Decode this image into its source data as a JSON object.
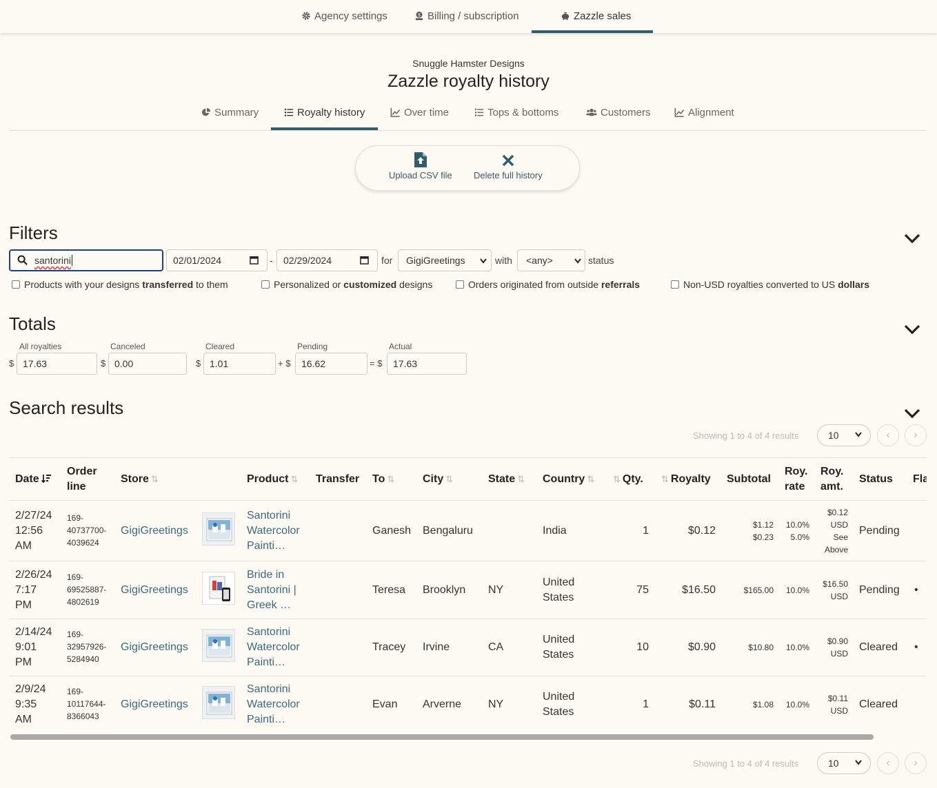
{
  "topnav": {
    "items": [
      {
        "label": "Agency settings",
        "icon": "gear-icon"
      },
      {
        "label": "Billing / subscription",
        "icon": "user-dollar-icon"
      },
      {
        "label": "Zazzle sales",
        "icon": "piggy-bank-icon"
      }
    ],
    "active_index": 2
  },
  "header": {
    "subtitle": "Snuggle Hamster Designs",
    "title": "Zazzle royalty history"
  },
  "tabs": [
    {
      "label": "Summary",
      "icon": "pie-chart-icon"
    },
    {
      "label": "Royalty history",
      "icon": "list-icon"
    },
    {
      "label": "Over time",
      "icon": "line-chart-icon"
    },
    {
      "label": "Tops & bottoms",
      "icon": "list-icon"
    },
    {
      "label": "Customers",
      "icon": "users-icon"
    },
    {
      "label": "Alignment",
      "icon": "line-chart-icon"
    }
  ],
  "actions": {
    "upload": "Upload CSV file",
    "delete": "Delete full history"
  },
  "filters": {
    "heading": "Filters",
    "search_value": "santorini",
    "date_from": "02/01/2024",
    "date_sep": "-",
    "date_to": "02/29/2024",
    "for_label": "for",
    "store_value": "GigiGreetings",
    "with_label": "with",
    "status_value": "<any>",
    "status_label": "status",
    "checkboxes": [
      {
        "pre": "Products with your designs ",
        "bold": "transferred",
        "post": " to them",
        "checked": false
      },
      {
        "pre": "Personalized or ",
        "bold": "customized",
        "post": " designs",
        "checked": false
      },
      {
        "pre": "Orders originated from outside ",
        "bold": "referrals",
        "post": "",
        "checked": false
      },
      {
        "pre": "Non-USD royalties converted to US ",
        "bold": "dollars",
        "post": "",
        "checked": false
      }
    ]
  },
  "totals": {
    "heading": "Totals",
    "currency": "$",
    "all_label": "All royalties",
    "all_value": "17.63",
    "canceled_label": "Canceled",
    "canceled_value": "0.00",
    "cleared_label": "Cleared",
    "cleared_value": "1.01",
    "plus": "+ $",
    "pending_label": "Pending",
    "pending_value": "16.62",
    "equals": "= $",
    "actual_label": "Actual",
    "actual_value": "17.63"
  },
  "results": {
    "heading": "Search results",
    "showing": "Showing 1 to 4 of 4 results",
    "page_size": "10",
    "prev": "‹",
    "next": "›",
    "columns": {
      "date": "Date",
      "order1": "Order",
      "order2": "line",
      "store": "Store",
      "product": "Product",
      "transfer": "Transfer",
      "to": "To",
      "city": "City",
      "state": "State",
      "country": "Country",
      "qty": "Qty.",
      "royalty": "Royalty",
      "subtotal": "Subtotal",
      "royrate1": "Roy.",
      "royrate2": "rate",
      "royamt1": "Roy.",
      "royamt2": "amt.",
      "status": "Status",
      "flag": "Fla"
    },
    "rows": [
      {
        "d1": "2/27/24",
        "d2": "12:56",
        "d3": "AM",
        "o1": "169-",
        "o2": "40737700-",
        "o3": "4039624",
        "store": "GigiGreetings",
        "p1": "Santorini",
        "p2": "Watercolor",
        "p3": "Painti…",
        "to": "Ganesh",
        "city": "Bengaluru",
        "state": "",
        "c1": "India",
        "c2": "",
        "qty": "1",
        "royalty": "$0.12",
        "s1": "$1.12",
        "s2": "$0.23",
        "r1": "10.0%",
        "r2": "5.0%",
        "a1": "$0.12",
        "a2": "USD",
        "a3": "See",
        "a4": "Above",
        "status": "Pending",
        "flag": ""
      },
      {
        "d1": "2/26/24",
        "d2": "7:17",
        "d3": "PM",
        "o1": "169-",
        "o2": "69525887-",
        "o3": "4802619",
        "store": "GigiGreetings",
        "p1": "Bride in",
        "p2": "Santorini |",
        "p3": "Greek …",
        "to": "Teresa",
        "city": "Brooklyn",
        "state": "NY",
        "c1": "United",
        "c2": "States",
        "qty": "75",
        "royalty": "$16.50",
        "s1": "$165.00",
        "s2": "",
        "r1": "10.0%",
        "r2": "",
        "a1": "$16.50",
        "a2": "USD",
        "a3": "",
        "a4": "",
        "status": "Pending",
        "flag": "•"
      },
      {
        "d1": "2/14/24",
        "d2": "9:01",
        "d3": "PM",
        "o1": "169-",
        "o2": "32957926-",
        "o3": "5284940",
        "store": "GigiGreetings",
        "p1": "Santorini",
        "p2": "Watercolor",
        "p3": "Painti…",
        "to": "Tracey",
        "city": "Irvine",
        "state": "CA",
        "c1": "United",
        "c2": "States",
        "qty": "10",
        "royalty": "$0.90",
        "s1": "$10.80",
        "s2": "",
        "r1": "10.0%",
        "r2": "",
        "a1": "$0.90",
        "a2": "USD",
        "a3": "",
        "a4": "",
        "status": "Cleared",
        "flag": "•"
      },
      {
        "d1": "2/9/24",
        "d2": "9:35",
        "d3": "AM",
        "o1": "169-",
        "o2": "10117644-",
        "o3": "8366043",
        "store": "GigiGreetings",
        "p1": "Santorini",
        "p2": "Watercolor",
        "p3": "Painti…",
        "to": "Evan",
        "city": "Arverne",
        "state": "NY",
        "c1": "United",
        "c2": "States",
        "qty": "1",
        "royalty": "$0.11",
        "s1": "$1.08",
        "s2": "",
        "r1": "10.0%",
        "r2": "",
        "a1": "$0.11",
        "a2": "USD",
        "a3": "",
        "a4": "",
        "status": "Cleared",
        "flag": ""
      }
    ]
  },
  "colors": {
    "accent": "#2f5d6b",
    "link": "#3b6a7a",
    "background": "#fdfaf3"
  }
}
